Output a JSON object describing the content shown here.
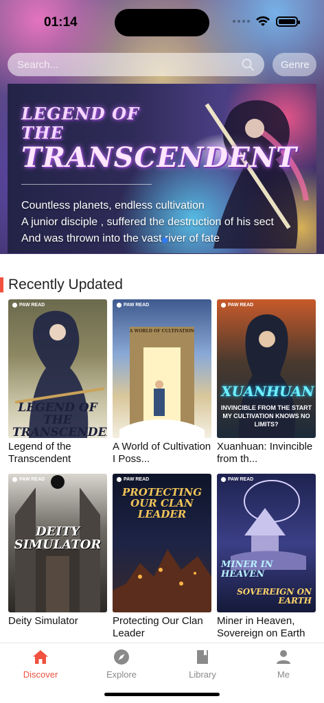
{
  "status": {
    "time": "01:14"
  },
  "search": {
    "placeholder": "Search...",
    "genre_label": "Genre"
  },
  "banner": {
    "title_line1": "LEGEND OF THE",
    "title_line2": "TRANSCENDENT",
    "lines": [
      "Countless planets, endless cultivation",
      "A junior disciple , suffered the destruction of his sect",
      "And was thrown into the vast river of fate"
    ]
  },
  "section": {
    "title": "Recently Updated"
  },
  "cover_logo": "PAW READ",
  "books": [
    {
      "title": "Legend of the Transcendent",
      "cover_text": "LEGEND OF THE TRANSCENDENT"
    },
    {
      "title": "A World of Cultivation I Poss...",
      "cover_text": "A WORLD OF CULTIVATION"
    },
    {
      "title": "Xuanhuan: Invincible from th...",
      "cover_text": "XUANHUAN",
      "cover_sub": "INVINCIBLE FROM THE START MY CULTIVATION KNOWS NO LIMITS?"
    },
    {
      "title": "Deity Simulator",
      "cover_text": "DEITY SIMULATOR"
    },
    {
      "title": "Protecting Our Clan Leader",
      "cover_text": "PROTECTING OUR CLAN LEADER"
    },
    {
      "title": "Miner in Heaven, Sovereign on Earth",
      "cover_text": "MINER IN HEAVEN",
      "cover_sub": "SOVEREIGN ON EARTH"
    }
  ],
  "tabs": [
    {
      "label": "Discover",
      "icon": "home-icon",
      "active": true
    },
    {
      "label": "Explore",
      "icon": "compass-icon",
      "active": false
    },
    {
      "label": "Library",
      "icon": "book-icon",
      "active": false
    },
    {
      "label": "Me",
      "icon": "person-icon",
      "active": false
    }
  ],
  "colors": {
    "accent": "#f0523f",
    "indicator": "#2e7bff"
  }
}
